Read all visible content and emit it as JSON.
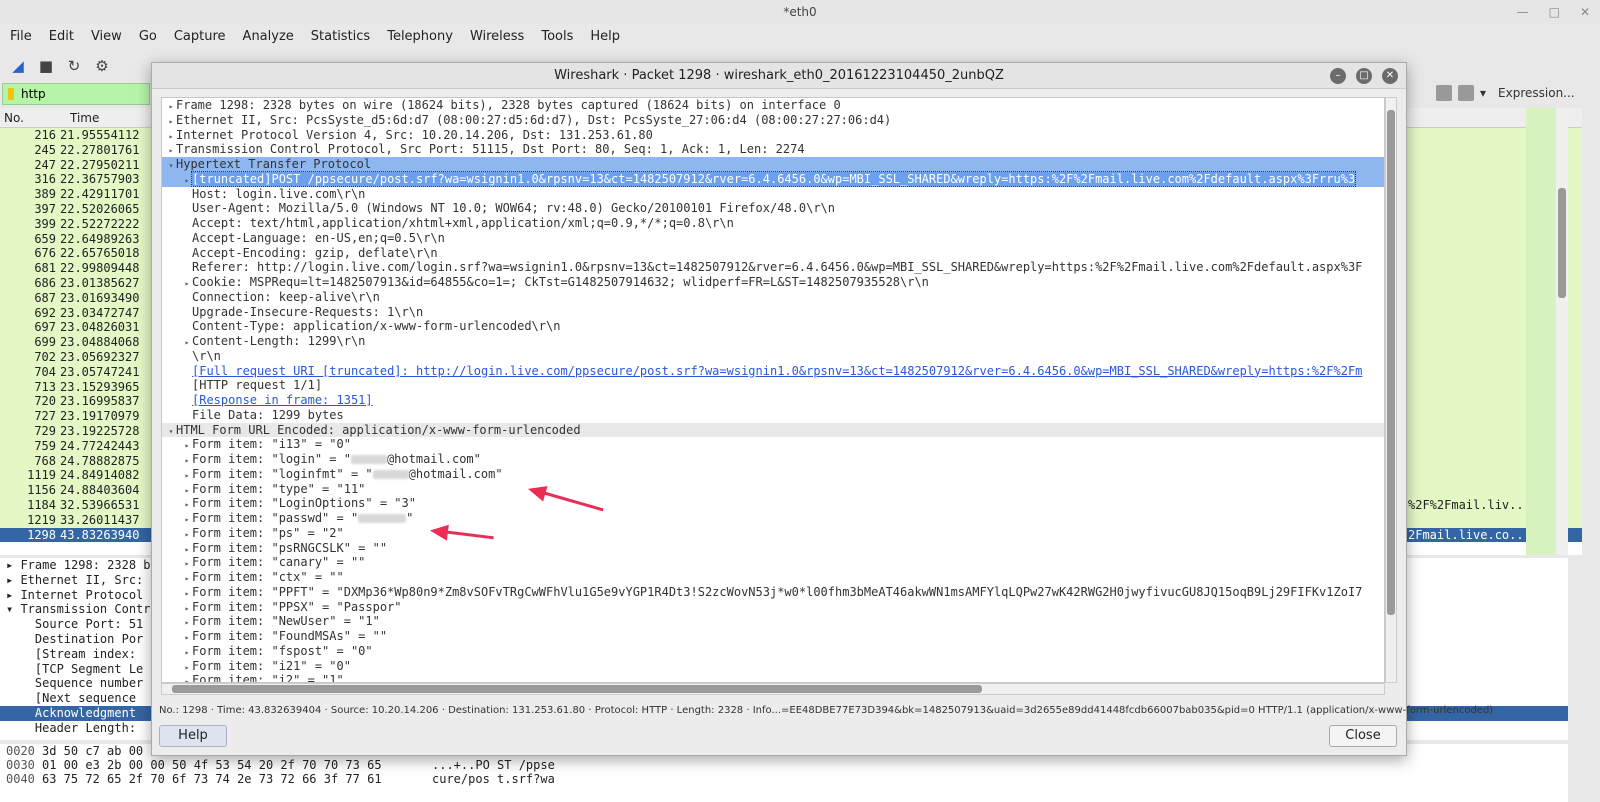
{
  "window": {
    "title": "*eth0"
  },
  "menu": [
    "File",
    "Edit",
    "View",
    "Go",
    "Capture",
    "Analyze",
    "Statistics",
    "Telephony",
    "Wireless",
    "Tools",
    "Help"
  ],
  "filter": {
    "value": "http",
    "expression_label": "Expression...",
    "add_label": "+"
  },
  "packet_list": {
    "headers": [
      "No.",
      "Time"
    ],
    "rows": [
      {
        "no": "216",
        "time": "21.95554112"
      },
      {
        "no": "245",
        "time": "22.27801761"
      },
      {
        "no": "247",
        "time": "22.27950211"
      },
      {
        "no": "316",
        "time": "22.36757903"
      },
      {
        "no": "389",
        "time": "22.42911701"
      },
      {
        "no": "397",
        "time": "22.52026065"
      },
      {
        "no": "399",
        "time": "22.52272222"
      },
      {
        "no": "659",
        "time": "22.64989263"
      },
      {
        "no": "676",
        "time": "22.65765018"
      },
      {
        "no": "681",
        "time": "22.99809448"
      },
      {
        "no": "686",
        "time": "23.01385627"
      },
      {
        "no": "687",
        "time": "23.01693490"
      },
      {
        "no": "692",
        "time": "23.03472747"
      },
      {
        "no": "697",
        "time": "23.04826031"
      },
      {
        "no": "699",
        "time": "23.04884068"
      },
      {
        "no": "702",
        "time": "23.05692327"
      },
      {
        "no": "704",
        "time": "23.05747241"
      },
      {
        "no": "713",
        "time": "23.15293965"
      },
      {
        "no": "720",
        "time": "23.16995837"
      },
      {
        "no": "727",
        "time": "23.19170979"
      },
      {
        "no": "729",
        "time": "23.19225728"
      },
      {
        "no": "759",
        "time": "24.77242443"
      },
      {
        "no": "768",
        "time": "24.78882875"
      },
      {
        "no": "1119",
        "time": "24.84914082"
      },
      {
        "no": "1156",
        "time": "24.88403604"
      },
      {
        "no": "1184",
        "time": "32.53966531",
        "info": "%2F%2Fmail.liv..."
      },
      {
        "no": "1219",
        "time": "33.26011437"
      },
      {
        "no": "1298",
        "time": "43.83263940",
        "info": "2Fmail.live.co...",
        "selected": true
      }
    ]
  },
  "details_pane": [
    {
      "text": "▸ Frame 1298: 2328 b"
    },
    {
      "text": "▸ Ethernet II, Src:"
    },
    {
      "text": "▸ Internet Protocol"
    },
    {
      "text": "▾ Transmission Contr"
    },
    {
      "text": "    Source Port: 51"
    },
    {
      "text": "    Destination Por"
    },
    {
      "text": "    [Stream index: "
    },
    {
      "text": "    [TCP Segment Le"
    },
    {
      "text": "    Sequence number"
    },
    {
      "text": "    [Next sequence "
    },
    {
      "text": "    Acknowledgment ",
      "selected": true
    },
    {
      "text": "    Header Length: "
    }
  ],
  "hex_pane": [
    {
      "off": "0020",
      "bytes": "3d 50 c7 ab 00",
      "ascii": ""
    },
    {
      "off": "0030",
      "bytes": "01 00 e3 2b 00 00 50 4f  53 54 20 2f 70 70 73 65",
      "ascii": "...+..PO ST /ppse"
    },
    {
      "off": "0040",
      "bytes": "63 75 72 65 2f 70 6f 73  74 2e 73 72 66 3f 77 61",
      "ascii": "cure/pos t.srf?wa"
    }
  ],
  "dialog": {
    "title": "Wireshark · Packet 1298 · wireshark_eth0_20161223104450_2unbQZ",
    "tree": [
      {
        "ar": "▸",
        "ind": 0,
        "text": "Frame 1298: 2328 bytes on wire (18624 bits), 2328 bytes captured (18624 bits) on interface 0"
      },
      {
        "ar": "▸",
        "ind": 0,
        "text": "Ethernet II, Src: PcsSyste_d5:6d:d7 (08:00:27:d5:6d:d7), Dst: PcsSyste_27:06:d4 (08:00:27:27:06:d4)"
      },
      {
        "ar": "▸",
        "ind": 0,
        "text": "Internet Protocol Version 4, Src: 10.20.14.206, Dst: 131.253.61.80"
      },
      {
        "ar": "▸",
        "ind": 0,
        "text": "Transmission Control Protocol, Src Port: 51115, Dst Port: 80, Seq: 1, Ack: 1, Len: 2274"
      },
      {
        "ar": "▾",
        "ind": 0,
        "text": "Hypertext Transfer Protocol",
        "hl": true
      },
      {
        "ar": "▸",
        "ind": 1,
        "text": "[truncated]POST /ppsecure/post.srf?wa=wsignin1.0&rpsnv=13&ct=1482507912&rver=6.4.6456.0&wp=MBI_SSL_SHARED&wreply=https:%2F%2Fmail.live.com%2Fdefault.aspx%3Frru%3",
        "hl": true,
        "selb": true
      },
      {
        "ar": "",
        "ind": 1,
        "text": "Host: login.live.com\\r\\n"
      },
      {
        "ar": "",
        "ind": 1,
        "text": "User-Agent: Mozilla/5.0 (Windows NT 10.0; WOW64; rv:48.0) Gecko/20100101 Firefox/48.0\\r\\n"
      },
      {
        "ar": "",
        "ind": 1,
        "text": "Accept: text/html,application/xhtml+xml,application/xml;q=0.9,*/*;q=0.8\\r\\n"
      },
      {
        "ar": "",
        "ind": 1,
        "text": "Accept-Language: en-US,en;q=0.5\\r\\n"
      },
      {
        "ar": "",
        "ind": 1,
        "text": "Accept-Encoding: gzip, deflate\\r\\n"
      },
      {
        "ar": "",
        "ind": 1,
        "text": "Referer: http://login.live.com/login.srf?wa=wsignin1.0&rpsnv=13&ct=1482507912&rver=6.4.6456.0&wp=MBI_SSL_SHARED&wreply=https:%2F%2Fmail.live.com%2Fdefault.aspx%3F"
      },
      {
        "ar": "▸",
        "ind": 1,
        "text": "Cookie: MSPRequ=lt=1482507913&id=64855&co=1=; CkTst=G1482507914632; wlidperf=FR=L&ST=1482507935528\\r\\n"
      },
      {
        "ar": "",
        "ind": 1,
        "text": "Connection: keep-alive\\r\\n"
      },
      {
        "ar": "",
        "ind": 1,
        "text": "Upgrade-Insecure-Requests: 1\\r\\n"
      },
      {
        "ar": "",
        "ind": 1,
        "text": "Content-Type: application/x-www-form-urlencoded\\r\\n"
      },
      {
        "ar": "▸",
        "ind": 1,
        "text": "Content-Length: 1299\\r\\n"
      },
      {
        "ar": "",
        "ind": 1,
        "text": "\\r\\n"
      },
      {
        "ar": "",
        "ind": 1,
        "text": "[Full request URI [truncated]: http://login.live.com/ppsecure/post.srf?wa=wsignin1.0&rpsnv=13&ct=1482507912&rver=6.4.6456.0&wp=MBI_SSL_SHARED&wreply=https:%2F%2Fm",
        "link": true
      },
      {
        "ar": "",
        "ind": 1,
        "text": "[HTTP request 1/1]"
      },
      {
        "ar": "",
        "ind": 1,
        "text": "[Response in frame: 1351]",
        "link": true
      },
      {
        "ar": "",
        "ind": 1,
        "text": "File Data: 1299 bytes"
      },
      {
        "ar": "▾",
        "ind": 0,
        "text": "HTML Form URL Encoded: application/x-www-form-urlencoded",
        "band": true
      },
      {
        "ar": "▸",
        "ind": 1,
        "text": "Form item: \"i13\" = \"0\""
      },
      {
        "ar": "▸",
        "ind": 1,
        "pre": "Form item: \"login\" = \"",
        "blurw": 36,
        "post": "@hotmail.com\""
      },
      {
        "ar": "▸",
        "ind": 1,
        "pre": "Form item: \"loginfmt\" = \"",
        "blurw": 36,
        "post": "@hotmail.com\""
      },
      {
        "ar": "▸",
        "ind": 1,
        "text": "Form item: \"type\" = \"11\""
      },
      {
        "ar": "▸",
        "ind": 1,
        "text": "Form item: \"LoginOptions\" = \"3\""
      },
      {
        "ar": "▸",
        "ind": 1,
        "pre": "Form item: \"passwd\" = \"",
        "blurw": 48,
        "post": "\""
      },
      {
        "ar": "▸",
        "ind": 1,
        "text": "Form item: \"ps\" = \"2\""
      },
      {
        "ar": "▸",
        "ind": 1,
        "text": "Form item: \"psRNGCSLK\" = \"\""
      },
      {
        "ar": "▸",
        "ind": 1,
        "text": "Form item: \"canary\" = \"\""
      },
      {
        "ar": "▸",
        "ind": 1,
        "text": "Form item: \"ctx\" = \"\""
      },
      {
        "ar": "▸",
        "ind": 1,
        "text": "Form item: \"PPFT\" = \"DXMp36*Wp80n9*Zm8vSOFvTRgCwWFhVlu1G5e9vYGP1R4Dt3!S2zcWovN53j*w0*l00fhm3bMeAT46akwWN1msAMFYlqLQPw27wK42RWG2H0jwyfivucGU8JQ15oqB9Lj29FIFKv1ZoI7"
      },
      {
        "ar": "▸",
        "ind": 1,
        "text": "Form item: \"PPSX\" = \"Passpor\""
      },
      {
        "ar": "▸",
        "ind": 1,
        "text": "Form item: \"NewUser\" = \"1\""
      },
      {
        "ar": "▸",
        "ind": 1,
        "text": "Form item: \"FoundMSAs\" = \"\""
      },
      {
        "ar": "▸",
        "ind": 1,
        "text": "Form item: \"fspost\" = \"0\""
      },
      {
        "ar": "▸",
        "ind": 1,
        "text": "Form item: \"i21\" = \"0\""
      },
      {
        "ar": "▸",
        "ind": 1,
        "text": "Form item: \"i2\" = \"1\""
      }
    ],
    "status": "No.: 1298 · Time: 43.832639404 · Source: 10.20.14.206 · Destination: 131.253.61.80 · Protocol: HTTP · Length: 2328 · Info...=EE48DBE77E73D394&bk=1482507913&uaid=3d2655e89dd41448fcdb66007bab035&pid=0 HTTP/1.1 (application/x-www-form-urlencoded)",
    "help_label": "Help",
    "close_label": "Close"
  },
  "colors": {
    "selected_row": "#3465a4",
    "http_row": "#e4f8c6",
    "tree_highlight": "#8fb7ef",
    "annotation_arrow": "#ea2d55",
    "filter_valid": "#b6f5a8"
  }
}
